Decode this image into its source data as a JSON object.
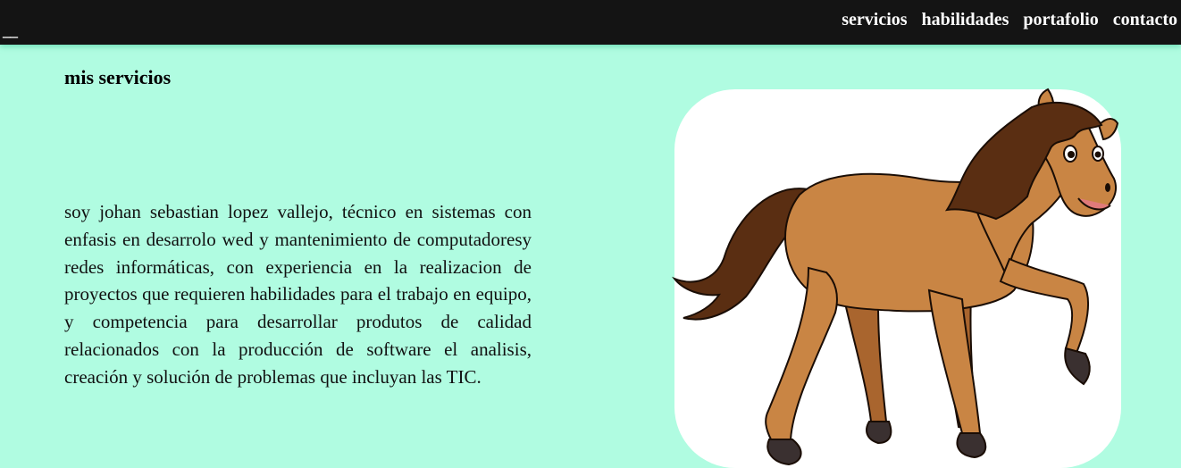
{
  "header": {
    "logo_text": "__",
    "nav": [
      {
        "label": "servicios"
      },
      {
        "label": "habilidades"
      },
      {
        "label": "portafolio"
      },
      {
        "label": "contacto"
      }
    ]
  },
  "main": {
    "section_title": "mis servicios",
    "bio": "soy johan sebastian lopez vallejo, técnico en sistemas con enfasis en desarrolo wed y mantenimiento de computadoresy redes informáticas, con experiencia en la realizacion de proyectos que requieren habilidades para el trabajo en equipo, y competencia para desarrollar produtos de calidad relacionados con la producción de software el analisis, creación y solución de problemas que incluyan las TIC."
  },
  "colors": {
    "background": "#b0fce1",
    "topbar": "#141414",
    "horse_body": "#c98544",
    "horse_mane": "#5a2e12"
  }
}
